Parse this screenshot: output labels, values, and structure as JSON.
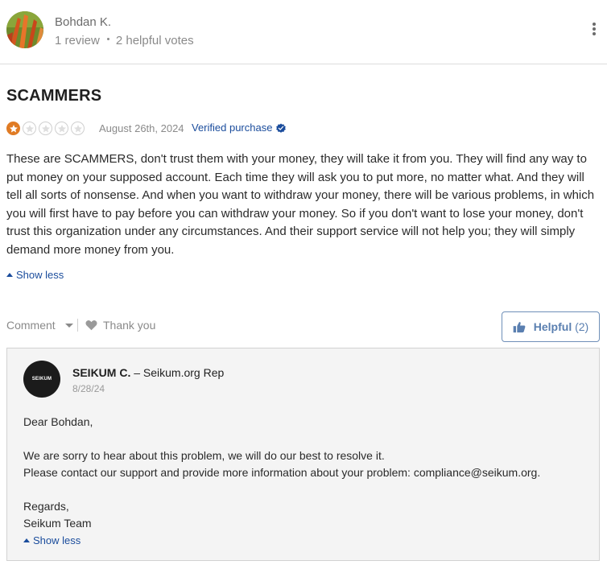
{
  "reviewer": {
    "name": "Bohdan K.",
    "reviews": "1 review",
    "votes": "2 helpful votes"
  },
  "review": {
    "title": "SCAMMERS",
    "rating": 1,
    "rating_max": 5,
    "date": "August 26th, 2024",
    "verified_label": "Verified purchase",
    "body": "These are SCAMMERS, don't trust them with your money, they will take it from you. They will find any way to put money on your supposed account. Each time they will ask you to put more, no matter what. And they will tell all sorts of nonsense. And when you want to withdraw your money, there will be various problems, in which you will first have to pay before you can withdraw your money. So if you don't want to lose your money, don't trust this organization under any circumstances. And their support service will not help you; they will simply demand more money from you.",
    "show_less": "Show less"
  },
  "actions": {
    "comment_label": "Comment",
    "thank_you_label": "Thank you",
    "helpful_label": "Helpful",
    "helpful_count": "(2)"
  },
  "reply": {
    "avatar_text": "SEIKUM",
    "name": "SEIKUM C.",
    "role": " – Seikum.org Rep",
    "date": "8/28/24",
    "greeting": "Dear Bohdan,",
    "line1": "We are sorry to hear about this problem, we will do our best to resolve it.",
    "line2": "Please contact our support and provide more information about your problem: compliance@seikum.org.",
    "closing": "Regards,",
    "signature": "Seikum Team",
    "show_less": "Show less"
  },
  "colors": {
    "accent_blue": "#1a4c9c",
    "star_orange": "#e07b24",
    "helpful_border": "#6f8fb8"
  }
}
